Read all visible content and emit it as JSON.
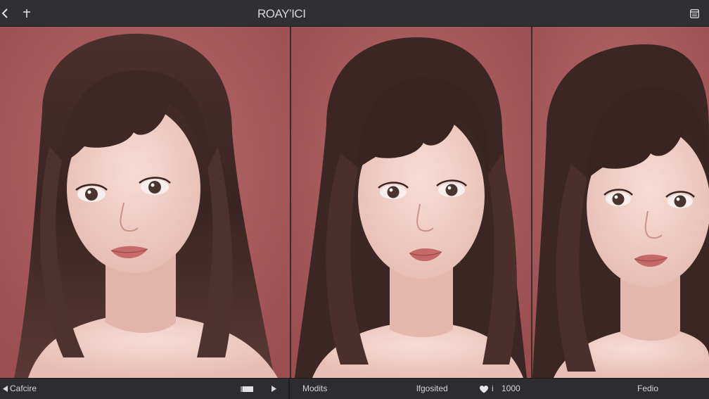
{
  "header": {
    "title": "ROAY’ICI",
    "back_icon": "chevron-left-icon",
    "add_icon": "plus-icon",
    "menu_icon": "sidebar-panel-icon"
  },
  "panels": [
    {
      "name": "left-portrait"
    },
    {
      "name": "middle-portrait"
    },
    {
      "name": "right-portrait"
    }
  ],
  "footer": {
    "left_label": "Cafcire",
    "left_icon": "triangle-left-icon",
    "left_controls": [
      "square-toggle-icon",
      "triangle-right-icon"
    ],
    "middle_label_a": "Modits",
    "middle_label_b": "lfgosited",
    "middle_value": "1000",
    "middle_icon": "heart-icon",
    "middle_suffix": "i",
    "right_label": "Fedio"
  },
  "colors": {
    "background_wall": "#a8595a",
    "toolbar": "#303032",
    "text": "#d8d8da",
    "hair": "#3a2522",
    "skin": "#f0cfc6"
  }
}
